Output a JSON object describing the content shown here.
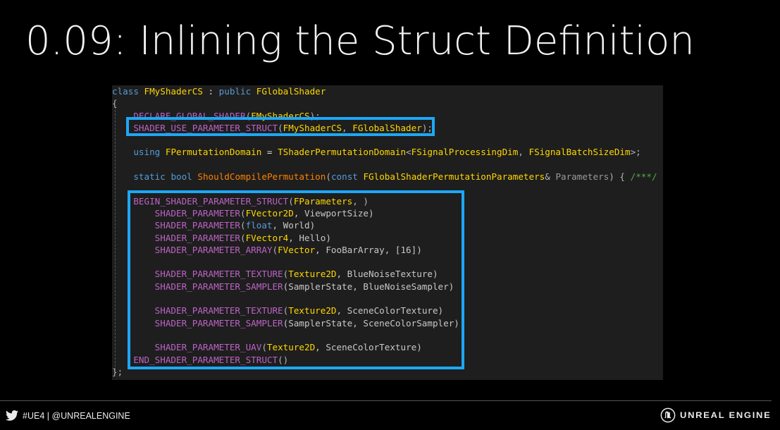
{
  "slide": {
    "title": "0.09: Inlining the Struct Definition"
  },
  "code": {
    "lines": [
      [
        [
          "class",
          "tok-kw"
        ],
        [
          " ",
          "tok-plain"
        ],
        [
          "FMyShaderCS",
          "tok-type"
        ],
        [
          " : ",
          "tok-plain"
        ],
        [
          "public",
          "tok-kw"
        ],
        [
          " ",
          "tok-plain"
        ],
        [
          "FGlobalShader",
          "tok-type"
        ]
      ],
      [
        [
          "{",
          "tok-punct"
        ]
      ],
      [
        [
          "    ",
          "tok-plain"
        ],
        [
          "DECLARE_GLOBAL_SHADER",
          "tok-macro"
        ],
        [
          "(",
          "tok-punct"
        ],
        [
          "FMyShaderCS",
          "tok-type"
        ],
        [
          ");",
          "tok-punct"
        ]
      ],
      [
        [
          "    ",
          "tok-plain"
        ],
        [
          "SHADER_USE_PARAMETER_STRUCT",
          "tok-macro"
        ],
        [
          "(",
          "tok-punct"
        ],
        [
          "FMyShaderCS",
          "tok-type"
        ],
        [
          ", ",
          "tok-punct"
        ],
        [
          "FGlobalShader",
          "tok-type"
        ],
        [
          ");",
          "tok-punct"
        ]
      ],
      [],
      [
        [
          "    ",
          "tok-plain"
        ],
        [
          "using",
          "tok-kw"
        ],
        [
          " ",
          "tok-plain"
        ],
        [
          "FPermutationDomain",
          "tok-type"
        ],
        [
          " = ",
          "tok-plain"
        ],
        [
          "TShaderPermutationDomain",
          "tok-type"
        ],
        [
          "<",
          "tok-punct"
        ],
        [
          "FSignalProcessingDim",
          "tok-type"
        ],
        [
          ", ",
          "tok-punct"
        ],
        [
          "FSignalBatchSizeDim",
          "tok-type"
        ],
        [
          ">;",
          "tok-punct"
        ]
      ],
      [],
      [
        [
          "    ",
          "tok-plain"
        ],
        [
          "static",
          "tok-kw"
        ],
        [
          " ",
          "tok-plain"
        ],
        [
          "bool",
          "tok-kw"
        ],
        [
          " ",
          "tok-plain"
        ],
        [
          "ShouldCompilePermutation",
          "tok-fn"
        ],
        [
          "(",
          "tok-punct"
        ],
        [
          "const",
          "tok-kw"
        ],
        [
          " ",
          "tok-plain"
        ],
        [
          "FGlobalShaderPermutationParameters",
          "tok-type"
        ],
        [
          "& ",
          "tok-punct"
        ],
        [
          "Parameters",
          "tok-param"
        ],
        [
          ") { ",
          "tok-punct"
        ],
        [
          "/***/",
          "tok-comment"
        ],
        [
          " }",
          "tok-punct"
        ]
      ],
      [],
      [
        [
          "    ",
          "tok-plain"
        ],
        [
          "BEGIN_SHADER_PARAMETER_STRUCT",
          "tok-macro"
        ],
        [
          "(",
          "tok-punct"
        ],
        [
          "FParameters",
          "tok-type"
        ],
        [
          ", )",
          "tok-punct"
        ]
      ],
      [
        [
          "        ",
          "tok-plain"
        ],
        [
          "SHADER_PARAMETER",
          "tok-macro"
        ],
        [
          "(",
          "tok-punct"
        ],
        [
          "FVector2D",
          "tok-type"
        ],
        [
          ", ViewportSize)",
          "tok-class"
        ]
      ],
      [
        [
          "        ",
          "tok-plain"
        ],
        [
          "SHADER_PARAMETER",
          "tok-macro"
        ],
        [
          "(",
          "tok-punct"
        ],
        [
          "float",
          "tok-kw"
        ],
        [
          ", World)",
          "tok-class"
        ]
      ],
      [
        [
          "        ",
          "tok-plain"
        ],
        [
          "SHADER_PARAMETER",
          "tok-macro"
        ],
        [
          "(",
          "tok-punct"
        ],
        [
          "FVector4",
          "tok-type"
        ],
        [
          ", Hello)",
          "tok-class"
        ]
      ],
      [
        [
          "        ",
          "tok-plain"
        ],
        [
          "SHADER_PARAMETER_ARRAY",
          "tok-macro"
        ],
        [
          "(",
          "tok-punct"
        ],
        [
          "FVector",
          "tok-type"
        ],
        [
          ", FooBarArray, [16])",
          "tok-class"
        ]
      ],
      [],
      [
        [
          "        ",
          "tok-plain"
        ],
        [
          "SHADER_PARAMETER_TEXTURE",
          "tok-macro"
        ],
        [
          "(",
          "tok-punct"
        ],
        [
          "Texture2D",
          "tok-type"
        ],
        [
          ", BlueNoiseTexture)",
          "tok-class"
        ]
      ],
      [
        [
          "        ",
          "tok-plain"
        ],
        [
          "SHADER_PARAMETER_SAMPLER",
          "tok-macro"
        ],
        [
          "(SamplerState, BlueNoiseSampler)",
          "tok-class"
        ]
      ],
      [],
      [
        [
          "        ",
          "tok-plain"
        ],
        [
          "SHADER_PARAMETER_TEXTURE",
          "tok-macro"
        ],
        [
          "(",
          "tok-punct"
        ],
        [
          "Texture2D",
          "tok-type"
        ],
        [
          ", SceneColorTexture)",
          "tok-class"
        ]
      ],
      [
        [
          "        ",
          "tok-plain"
        ],
        [
          "SHADER_PARAMETER_SAMPLER",
          "tok-macro"
        ],
        [
          "(SamplerState, SceneColorSampler)",
          "tok-class"
        ]
      ],
      [],
      [
        [
          "        ",
          "tok-plain"
        ],
        [
          "SHADER_PARAMETER_UAV",
          "tok-macro"
        ],
        [
          "(",
          "tok-punct"
        ],
        [
          "Texture2D",
          "tok-type"
        ],
        [
          ", SceneColorTexture)",
          "tok-class"
        ]
      ],
      [
        [
          "    ",
          "tok-plain"
        ],
        [
          "END_SHADER_PARAMETER_STRUCT",
          "tok-macro"
        ],
        [
          "()",
          "tok-punct"
        ]
      ],
      [
        [
          "};",
          "tok-punct"
        ]
      ]
    ]
  },
  "footer": {
    "social": "#UE4 | @UNREALENGINE",
    "brand": "UNREAL ENGINE",
    "icons": [
      "twitter-icon",
      "unreal-engine-logo-icon"
    ]
  },
  "colors": {
    "highlight": "#1ea7f5",
    "code_bg": "#1e1e1e",
    "slide_bg": "#000000"
  }
}
